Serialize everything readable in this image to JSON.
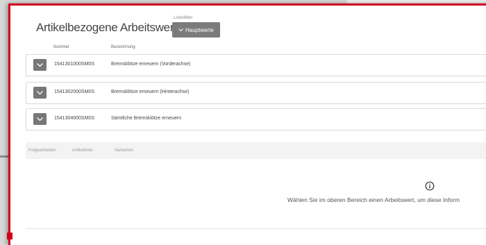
{
  "header": {
    "title": "Artikelbezogene Arbeitswerte",
    "filter_label": "Listenfilter",
    "filter_button_label": "Hauptwerte"
  },
  "table": {
    "columns": [
      "Nummer",
      "Bezeichnung"
    ],
    "rows": [
      {
        "number": "1541301000SM0S",
        "description": "Bremsklötze erneuern (Vorderachse)"
      },
      {
        "number": "1541302000SM0S",
        "description": "Bremsklötze erneuern (Hinterachse)"
      },
      {
        "number": "1541304000SM0S",
        "description": "Sämtliche Bremsklötze erneuern"
      }
    ]
  },
  "tabs": [
    "Folgearbeiten",
    "Artikelliste",
    "Varianten"
  ],
  "info": {
    "icon": "info-circle-icon",
    "message": "Wählen Sie im oberen Bereich einen Arbeitswert, um diese Inform"
  },
  "colors": {
    "accent": "#d0021b",
    "button": "#7b7b7b"
  }
}
